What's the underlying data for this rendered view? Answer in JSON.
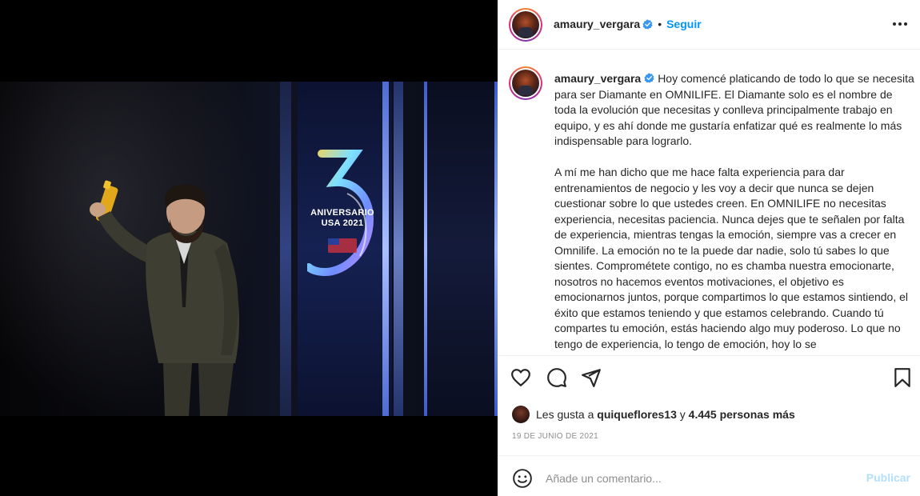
{
  "post": {
    "username": "amaury_vergara",
    "verified": true,
    "follow_label": "Seguir",
    "separator": "•",
    "media_text": "ANIVERSARIO USA 2021",
    "caption_paragraphs": [
      "Hoy comencé platicando de todo lo que se necesita para ser Diamante en OMNILIFE. El Diamante solo es el nombre de toda la evolución que necesitas y conlleva principalmente trabajo en equipo, y es ahí donde me gustaría enfatizar qué es realmente lo más indispensable para lograrlo.",
      "A mí me han dicho que me hace falta experiencia para dar entrenamientos de negocio y les voy a decir que nunca se dejen cuestionar sobre lo que ustedes creen. En OMNILIFE no necesitas experiencia, necesitas paciencia. Nunca dejes que te señalen por falta de experiencia, mientras tengas la emoción, siempre vas a crecer en Omnilife. La emoción no te la puede dar nadie, solo tú sabes lo que sientes. Comprométete contigo, no es chamba nuestra emocionarte, nosotros no hacemos eventos motivaciones, el objetivo es emocionarnos juntos, porque compartimos lo que estamos sintiendo, el éxito que estamos teniendo y que estamos celebrando. Cuando tú compartes tu emoción, estás haciendo algo muy poderoso. Lo que no tengo de experiencia, lo tengo de emoción, hoy lo se"
    ],
    "likes": {
      "prefix": "Les gusta a",
      "first_user": "quiqueflores13",
      "connector": "y",
      "others": "4.445 personas más"
    },
    "date": "19 DE JUNIO DE 2021",
    "comment_placeholder": "Añade un comentario...",
    "publish_label": "Publicar"
  },
  "colors": {
    "link_blue": "#0095f6",
    "publish_disabled": "#b2dffc",
    "muted": "#8e8e8e"
  },
  "icons": [
    "verified-badge-icon",
    "more-options-icon",
    "heart-icon",
    "comment-icon",
    "share-icon",
    "bookmark-icon",
    "emoji-icon"
  ]
}
